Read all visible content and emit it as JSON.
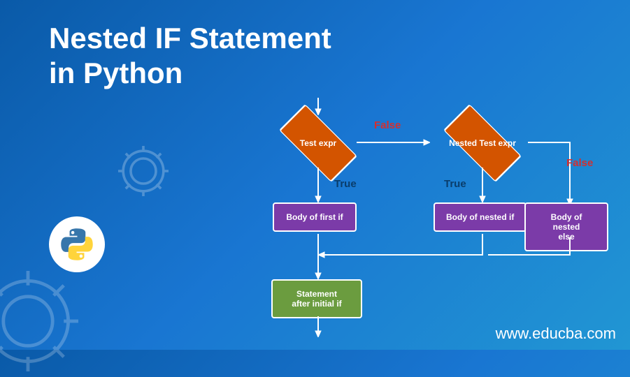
{
  "title_line1": "Nested IF Statement",
  "title_line2": "in Python",
  "url": "www.educba.com",
  "flowchart": {
    "diamond1": "Test expr",
    "diamond2": "Nested Test  expr",
    "box1": "Body of first if",
    "box2": "Body of nested if",
    "box3": "Body of nested else",
    "box4_line1": "Statement",
    "box4_line2": "after initial if",
    "label_false1": "False",
    "label_false2": "False",
    "label_true1": "True",
    "label_true2": "True"
  }
}
